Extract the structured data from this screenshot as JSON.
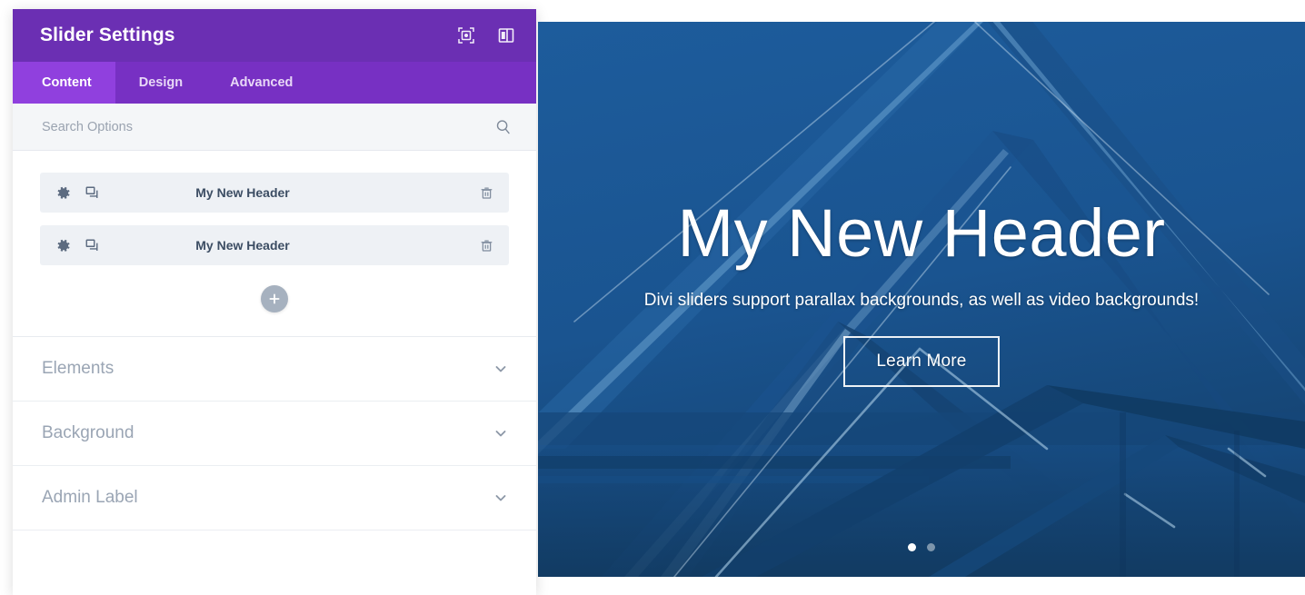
{
  "panel": {
    "title": "Slider Settings",
    "titlebar_icons": [
      {
        "name": "focus-target-icon",
        "label": "Focus"
      },
      {
        "name": "panel-layout-icon",
        "label": "Layout"
      }
    ],
    "tabs": [
      {
        "label": "Content",
        "active": true
      },
      {
        "label": "Design",
        "active": false
      },
      {
        "label": "Advanced",
        "active": false
      }
    ],
    "search": {
      "placeholder": "Search Options",
      "value": ""
    },
    "slides": [
      {
        "title": "My New Header"
      },
      {
        "title": "My New Header"
      }
    ],
    "add_slide_label": "+",
    "sections": [
      {
        "label": "Elements"
      },
      {
        "label": "Background"
      },
      {
        "label": "Admin Label"
      }
    ]
  },
  "slider": {
    "heading": "My New Header",
    "subtitle": "Divi sliders support parallax backgrounds, as well as video backgrounds!",
    "cta_label": "Learn More",
    "dots": [
      {
        "active": true
      },
      {
        "active": false
      }
    ]
  },
  "colors": {
    "titlebar_purple": "#6b2fb3",
    "tabbar_purple": "#7730c3",
    "active_tab_purple": "#9040de",
    "slide_row_bg": "#eef1f5",
    "slider_blue": "#1b5693",
    "section_label": "#9aa5b4"
  }
}
